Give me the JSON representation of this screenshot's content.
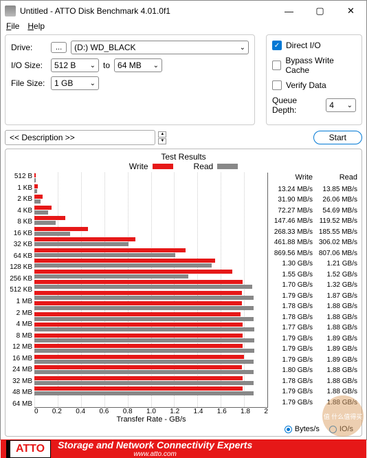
{
  "window": {
    "title": "Untitled - ATTO Disk Benchmark 4.01.0f1"
  },
  "menu": {
    "file": "File",
    "help": "Help"
  },
  "controls": {
    "drive_label": "Drive:",
    "drive_btn": "...",
    "drive_value": "(D:) WD_BLACK",
    "io_label": "I/O Size:",
    "io_from": "512 B",
    "io_to_label": "to",
    "io_to": "64 MB",
    "fs_label": "File Size:",
    "fs_value": "1 GB",
    "direct_io": "Direct I/O",
    "bypass": "Bypass Write Cache",
    "verify": "Verify Data",
    "qd_label": "Queue Depth:",
    "qd_value": "4",
    "desc_label": "<< Description >>",
    "start": "Start"
  },
  "chart": {
    "title": "Test Results",
    "write": "Write",
    "read": "Read",
    "xlabel": "Transfer Rate - GB/s",
    "bytes": "Bytes/s",
    "ios": "IO/s"
  },
  "chart_data": {
    "type": "bar",
    "xlabel": "Transfer Rate - GB/s",
    "xlim": [
      0,
      2
    ],
    "xticks": [
      "0",
      "0.2",
      "0.4",
      "0.6",
      "0.8",
      "1.0",
      "1.2",
      "1.4",
      "1.6",
      "1.8",
      "2"
    ],
    "categories": [
      "512 B",
      "1 KB",
      "2 KB",
      "4 KB",
      "8 KB",
      "16 KB",
      "32 KB",
      "64 KB",
      "128 KB",
      "256 KB",
      "512 KB",
      "1 MB",
      "2 MB",
      "4 MB",
      "8 MB",
      "12 MB",
      "16 MB",
      "24 MB",
      "32 MB",
      "48 MB",
      "64 MB"
    ],
    "series": [
      {
        "name": "Write",
        "display": [
          "13.24 MB/s",
          "31.90 MB/s",
          "72.27 MB/s",
          "147.46 MB/s",
          "268.33 MB/s",
          "461.88 MB/s",
          "869.56 MB/s",
          "1.30 GB/s",
          "1.55 GB/s",
          "1.70 GB/s",
          "1.79 GB/s",
          "1.78 GB/s",
          "1.78 GB/s",
          "1.77 GB/s",
          "1.79 GB/s",
          "1.79 GB/s",
          "1.79 GB/s",
          "1.80 GB/s",
          "1.78 GB/s",
          "1.79 GB/s",
          "1.79 GB/s"
        ],
        "values_gb": [
          0.01324,
          0.0319,
          0.07227,
          0.14746,
          0.26833,
          0.46188,
          0.86956,
          1.3,
          1.55,
          1.7,
          1.79,
          1.78,
          1.78,
          1.77,
          1.79,
          1.79,
          1.79,
          1.8,
          1.78,
          1.79,
          1.79
        ]
      },
      {
        "name": "Read",
        "display": [
          "13.85 MB/s",
          "26.06 MB/s",
          "54.69 MB/s",
          "119.52 MB/s",
          "185.55 MB/s",
          "306.02 MB/s",
          "807.06 MB/s",
          "1.21 GB/s",
          "1.52 GB/s",
          "1.32 GB/s",
          "1.87 GB/s",
          "1.88 GB/s",
          "1.88 GB/s",
          "1.88 GB/s",
          "1.89 GB/s",
          "1.89 GB/s",
          "1.89 GB/s",
          "1.88 GB/s",
          "1.88 GB/s",
          "1.88 GB/s",
          "1.88 GB/s"
        ],
        "values_gb": [
          0.01385,
          0.02606,
          0.05469,
          0.11952,
          0.18555,
          0.30602,
          0.80706,
          1.21,
          1.52,
          1.32,
          1.87,
          1.88,
          1.88,
          1.88,
          1.89,
          1.89,
          1.89,
          1.88,
          1.88,
          1.88,
          1.88
        ]
      }
    ]
  },
  "footer": {
    "logo": "ATTO",
    "tagline": "Storage and Network Connectivity Experts",
    "url": "www.atto.com"
  },
  "watermark": "值 什么值得买"
}
